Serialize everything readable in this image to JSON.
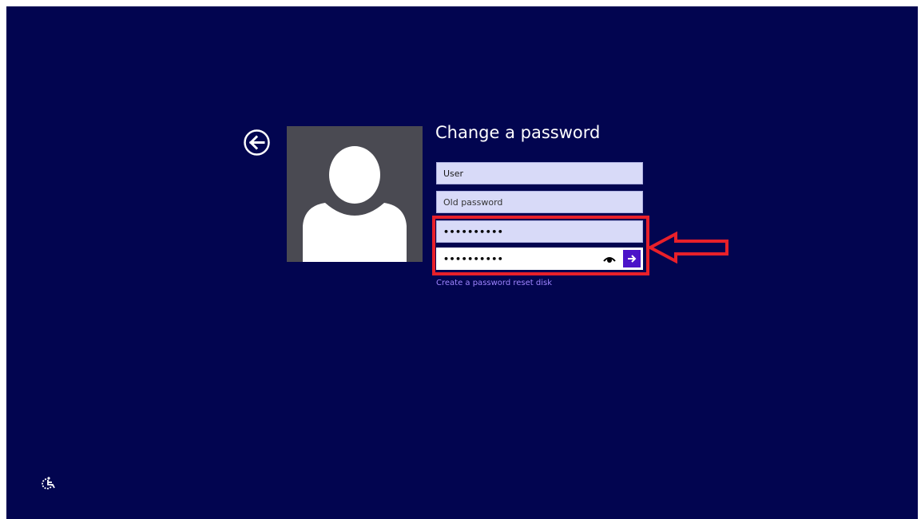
{
  "screen": {
    "background_color": "#020550"
  },
  "header": {
    "title": "Change a password"
  },
  "form": {
    "user_value": "User",
    "old_password_placeholder": "Old password",
    "new_password_value": "••••••••••",
    "confirm_password_value": "••••••••••",
    "reset_link_text": "Create a password reset disk"
  },
  "icons": {
    "back": "back-arrow-icon",
    "avatar": "user-avatar-icon",
    "reveal": "eye-icon",
    "submit": "right-arrow-icon",
    "ease_of_access": "ease-of-access-icon"
  },
  "colors": {
    "accent": "#4c14c8",
    "highlight": "#e8202a",
    "link": "#9f85ff",
    "field": "#d8daf8"
  }
}
